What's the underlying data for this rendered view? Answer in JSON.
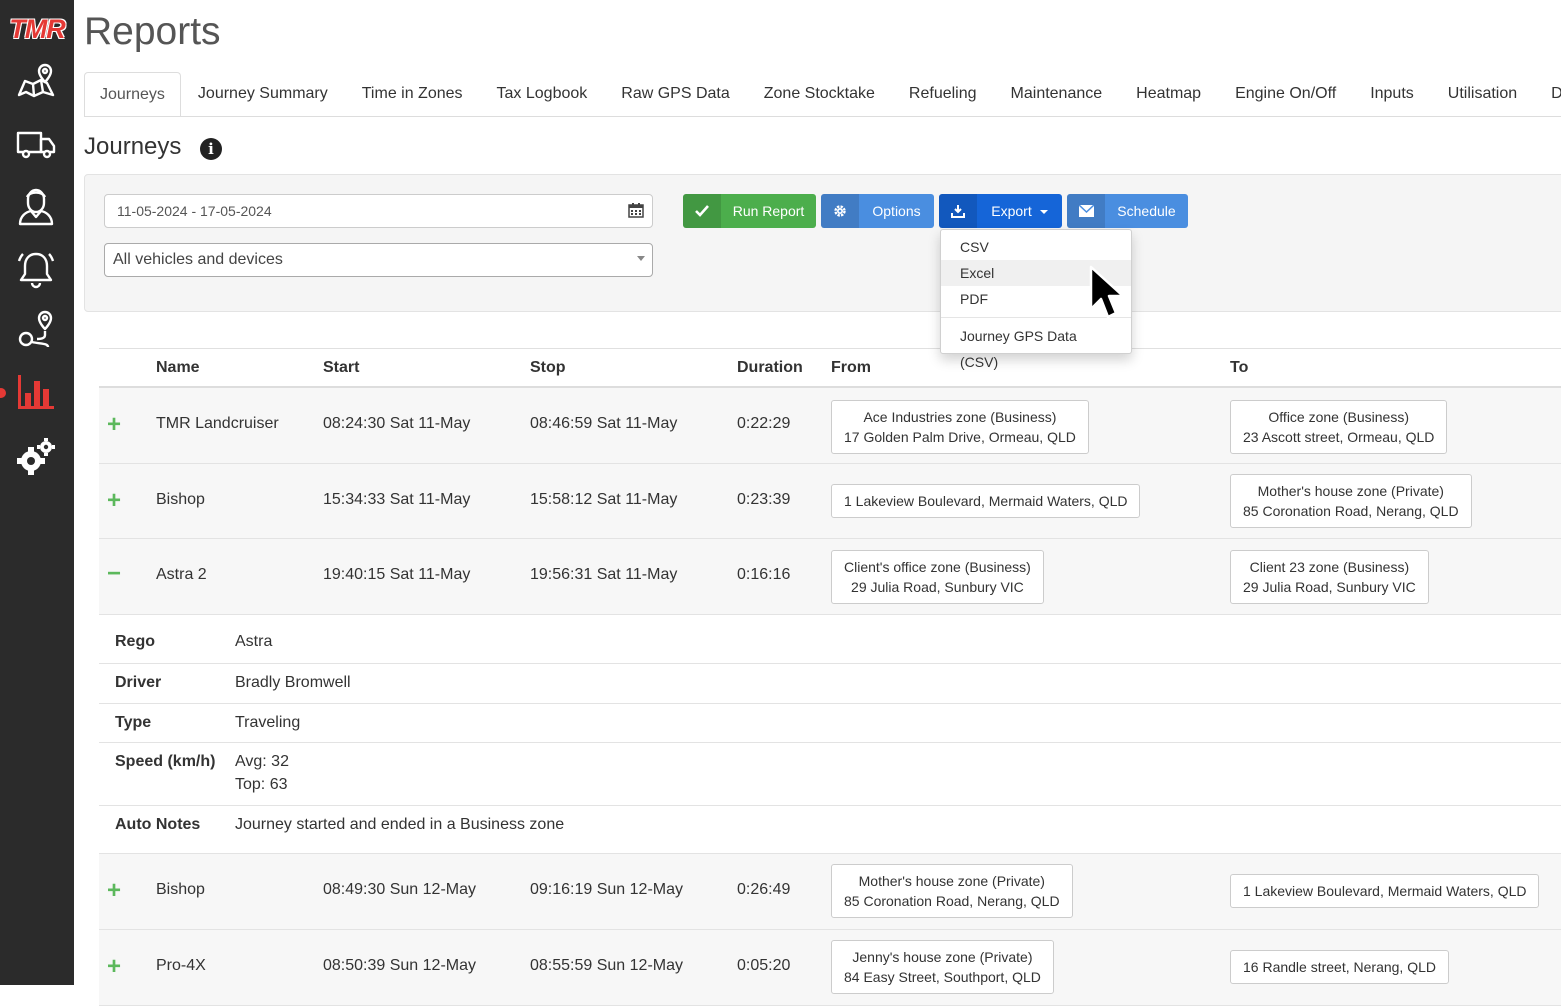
{
  "app": {
    "logo": "TMR",
    "accent": "#e53935"
  },
  "sidebar": {
    "items": [
      {
        "icon": "map-icon"
      },
      {
        "icon": "truck-icon"
      },
      {
        "icon": "driver-icon"
      },
      {
        "icon": "bell-icon"
      },
      {
        "icon": "route-icon"
      },
      {
        "icon": "bar-chart-icon",
        "active": true
      },
      {
        "icon": "gears-icon"
      }
    ]
  },
  "page": {
    "title": "Reports"
  },
  "tabs": [
    {
      "label": "Journeys",
      "active": true
    },
    {
      "label": "Journey Summary"
    },
    {
      "label": "Time in Zones"
    },
    {
      "label": "Tax Logbook"
    },
    {
      "label": "Raw GPS Data"
    },
    {
      "label": "Zone Stocktake"
    },
    {
      "label": "Refueling"
    },
    {
      "label": "Maintenance"
    },
    {
      "label": "Heatmap"
    },
    {
      "label": "Engine On/Off"
    },
    {
      "label": "Inputs"
    },
    {
      "label": "Utilisation"
    },
    {
      "label": "Dr"
    }
  ],
  "section": {
    "title": "Journeys"
  },
  "filters": {
    "date_range": "11-05-2024 - 17-05-2024",
    "vehicles": "All vehicles and devices"
  },
  "buttons": {
    "run_report": "Run Report",
    "options": "Options",
    "export": "Export",
    "schedule": "Schedule"
  },
  "export_menu": {
    "items": [
      "CSV",
      "Excel",
      "PDF"
    ],
    "extra": "Journey GPS Data (CSV)",
    "hovered": "Excel"
  },
  "table": {
    "headers": {
      "name": "Name",
      "start": "Start",
      "stop": "Stop",
      "duration": "Duration",
      "from": "From",
      "to": "To"
    },
    "rows": [
      {
        "toggle": "+",
        "name": "TMR Landcruiser",
        "start": "08:24:30 Sat 11-May",
        "stop": "08:46:59 Sat 11-May",
        "duration": "0:22:29",
        "from_1": "Ace Industries zone (Business)",
        "from_2": "17 Golden Palm Drive, Ormeau, QLD",
        "to_1": "Office zone (Business)",
        "to_2": "23 Ascott street, Ormeau, QLD"
      },
      {
        "toggle": "+",
        "name": "Bishop",
        "start": "15:34:33 Sat 11-May",
        "stop": "15:58:12 Sat 11-May",
        "duration": "0:23:39",
        "from_1": "1 Lakeview Boulevard, Mermaid Waters, QLD",
        "to_1": "Mother's house zone (Private)",
        "to_2": "85 Coronation Road, Nerang, QLD"
      },
      {
        "toggle": "−",
        "name": "Astra 2",
        "start": "19:40:15 Sat 11-May",
        "stop": "19:56:31 Sat 11-May",
        "duration": "0:16:16",
        "from_1": "Client's office zone (Business)",
        "from_2": "29 Julia Road, Sunbury VIC",
        "to_1": "Client 23 zone (Business)",
        "to_2": "29 Julia Road, Sunbury VIC"
      },
      {
        "toggle": "+",
        "name": "Bishop",
        "start": "08:49:30 Sun 12-May",
        "stop": "09:16:19 Sun 12-May",
        "duration": "0:26:49",
        "from_1": "Mother's house zone (Private)",
        "from_2": "85 Coronation Road, Nerang, QLD",
        "to_1": "1 Lakeview Boulevard, Mermaid Waters, QLD"
      },
      {
        "toggle": "+",
        "name": "Pro-4X",
        "start": "08:50:39 Sun 12-May",
        "stop": "08:55:59 Sun 12-May",
        "duration": "0:05:20",
        "from_1": "Jenny's house zone (Private)",
        "from_2": "84 Easy Street, Southport, QLD",
        "to_1": "16 Randle street, Nerang, QLD"
      }
    ],
    "detail": {
      "rego_label": "Rego",
      "rego": "Astra",
      "driver_label": "Driver",
      "driver": "Bradly Bromwell",
      "type_label": "Type",
      "type": "Traveling",
      "speed_label": "Speed (km/h)",
      "speed_avg": "Avg: 32",
      "speed_top": "Top: 63",
      "notes_label": "Auto Notes",
      "notes": "Journey started and ended in a Business zone"
    }
  }
}
